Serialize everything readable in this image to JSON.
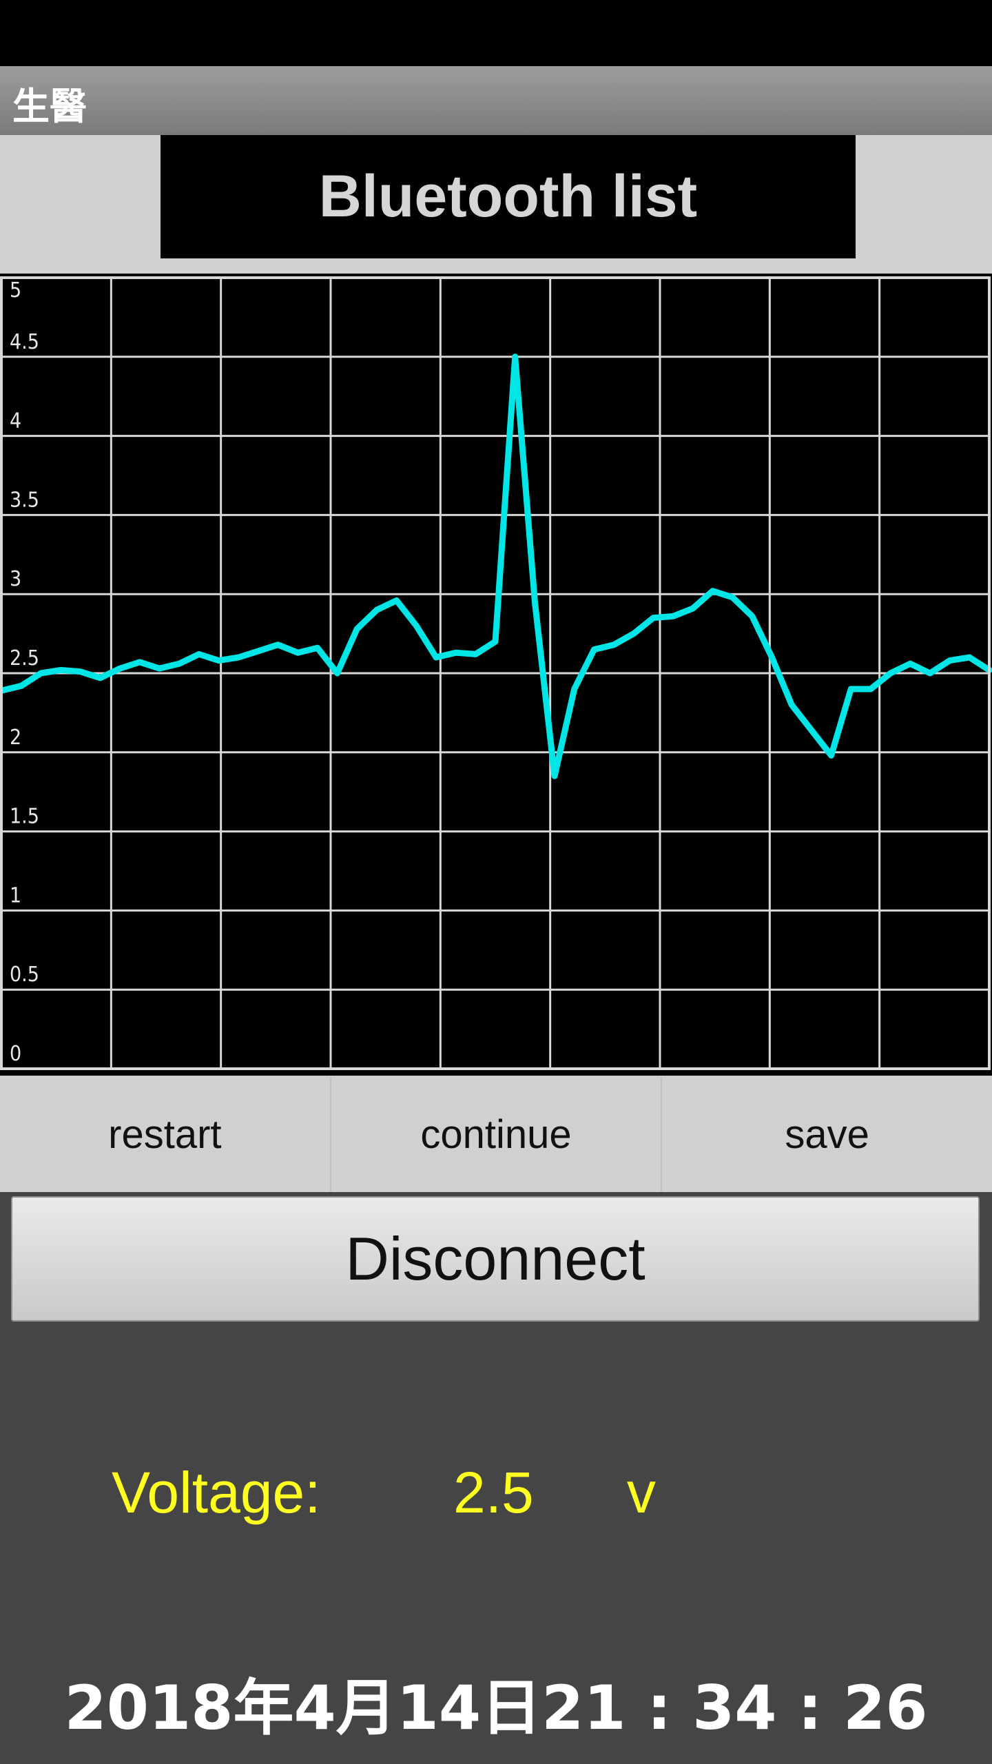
{
  "app": {
    "title": "生醫"
  },
  "bluetooth_button": {
    "label": "Bluetooth list"
  },
  "chart_data": {
    "type": "line",
    "ylim": [
      0,
      5
    ],
    "y_ticks": [
      "0",
      "0.5",
      "1",
      "1.5",
      "2",
      "2.5",
      "3",
      "3.5",
      "4",
      "4.5",
      "5"
    ],
    "grid": true,
    "line_color": "#00e5e5",
    "series": [
      {
        "values": [
          2.39,
          2.42,
          2.5,
          2.52,
          2.51,
          2.47,
          2.53,
          2.57,
          2.53,
          2.56,
          2.62,
          2.58,
          2.6,
          2.64,
          2.68,
          2.63,
          2.66,
          2.5,
          2.78,
          2.9,
          2.96,
          2.8,
          2.6,
          2.63,
          2.62,
          2.7,
          4.5,
          2.95,
          1.85,
          2.4,
          2.65,
          2.68,
          2.75,
          2.85,
          2.86,
          2.91,
          3.02,
          2.98,
          2.86,
          2.6,
          2.3,
          2.14,
          1.98,
          2.4,
          2.4,
          2.5,
          2.56,
          2.5,
          2.58,
          2.6,
          2.52
        ]
      }
    ]
  },
  "controls": {
    "restart": "restart",
    "continue": "continue",
    "save": "save"
  },
  "disconnect_button": {
    "label": "Disconnect"
  },
  "voltage": {
    "label": "Voltage:",
    "value": "2.5",
    "unit": "v"
  },
  "datetime": "2018年4月14日21 : 34 : 26"
}
